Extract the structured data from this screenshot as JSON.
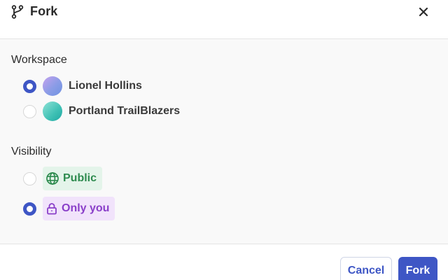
{
  "dialog": {
    "title": "Fork",
    "close_icon": "close-icon",
    "title_icon": "fork-icon"
  },
  "workspace": {
    "label": "Workspace",
    "options": [
      {
        "name": "Lionel Hollins",
        "selected": true,
        "avatar": "avatar"
      },
      {
        "name": "Portland TrailBlazers",
        "selected": false,
        "avatar": "avatar"
      }
    ]
  },
  "visibility": {
    "label": "Visibility",
    "options": [
      {
        "label": "Public",
        "icon": "globe-icon",
        "selected": false
      },
      {
        "label": "Only you",
        "icon": "lock-icon",
        "selected": true
      }
    ]
  },
  "footer": {
    "cancel_label": "Cancel",
    "fork_label": "Fork"
  },
  "colors": {
    "accent": "#3e56c5",
    "public_text": "#2e8b4f",
    "public_bg": "#e4f4ea",
    "private_text": "#8a3fc9",
    "private_bg": "#f1e3fb"
  }
}
